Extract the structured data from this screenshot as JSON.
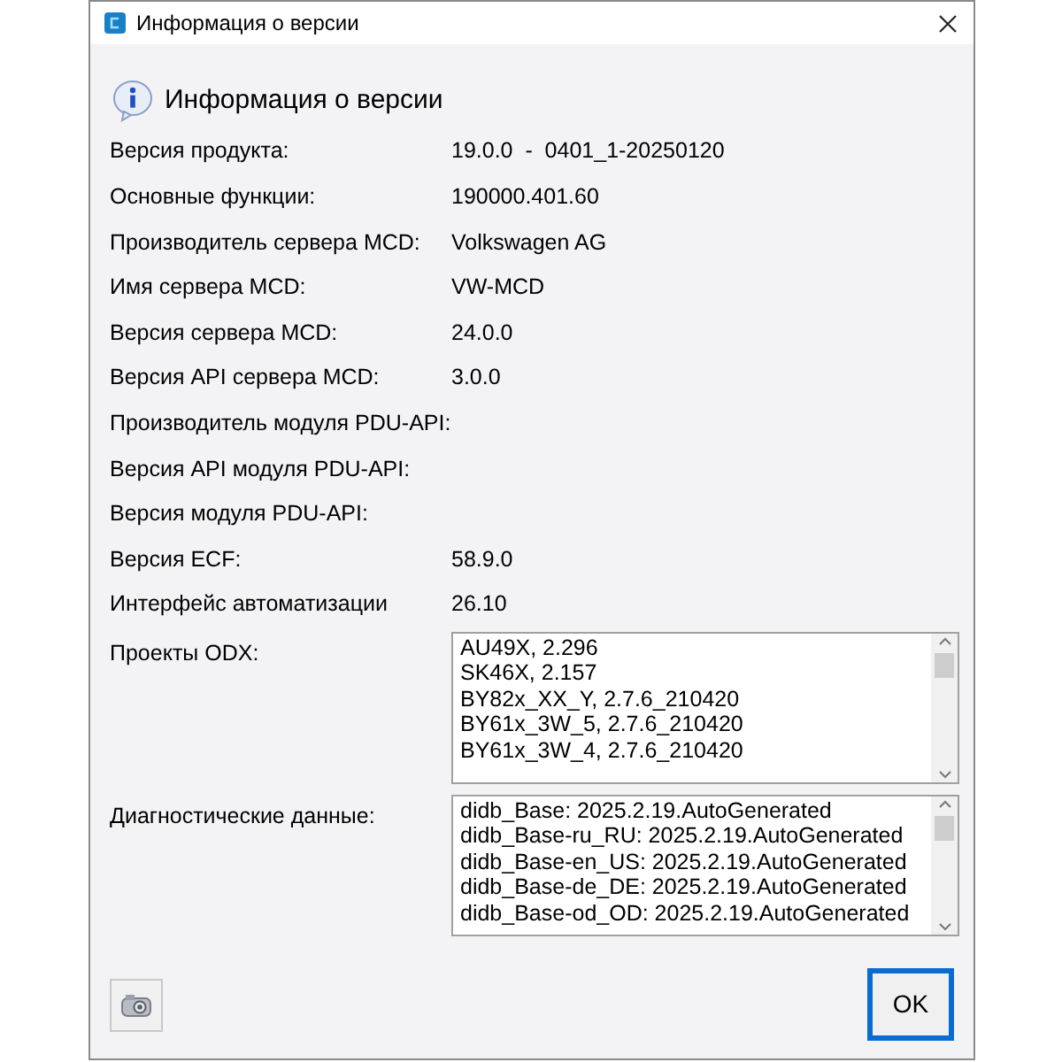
{
  "window": {
    "title": "Информация о версии"
  },
  "header": {
    "title": "Информация о версии"
  },
  "fields": [
    {
      "label": "Версия продукта:",
      "value": "19.0.0  -  0401_1-20250120"
    },
    {
      "label": "Основные функции:",
      "value": "190000.401.60"
    },
    {
      "label": "Производитель сервера MCD:",
      "value": "Volkswagen AG"
    },
    {
      "label": "Имя сервера MCD:",
      "value": "VW-MCD"
    },
    {
      "label": "Версия сервера MCD:",
      "value": "24.0.0"
    },
    {
      "label": "Версия API сервера MCD:",
      "value": "3.0.0"
    },
    {
      "label": "Производитель модуля PDU-API:"
    },
    {
      "label": "Версия API модуля PDU-API:"
    },
    {
      "label": "Версия модуля PDU-API:"
    },
    {
      "label": "Версия ECF:",
      "value": "58.9.0"
    },
    {
      "label": "Интерфейс автоматизации",
      "value": "26.10"
    }
  ],
  "lists": [
    {
      "label": "Проекты ODX:",
      "items": [
        "AU49X, 2.296",
        "SK46X, 2.157",
        "BY82x_XX_Y, 2.7.6_210420",
        "BY61x_3W_5, 2.7.6_210420",
        "BY61x_3W_4, 2.7.6_210420"
      ]
    },
    {
      "label": "Диагностические данные:",
      "items": [
        "didb_Base: 2025.2.19.AutoGenerated",
        "didb_Base-ru_RU: 2025.2.19.AutoGenerated",
        "didb_Base-en_US: 2025.2.19.AutoGenerated",
        "didb_Base-de_DE: 2025.2.19.AutoGenerated",
        "didb_Base-od_OD: 2025.2.19.AutoGenerated"
      ]
    }
  ],
  "buttons": {
    "ok": "OK"
  }
}
